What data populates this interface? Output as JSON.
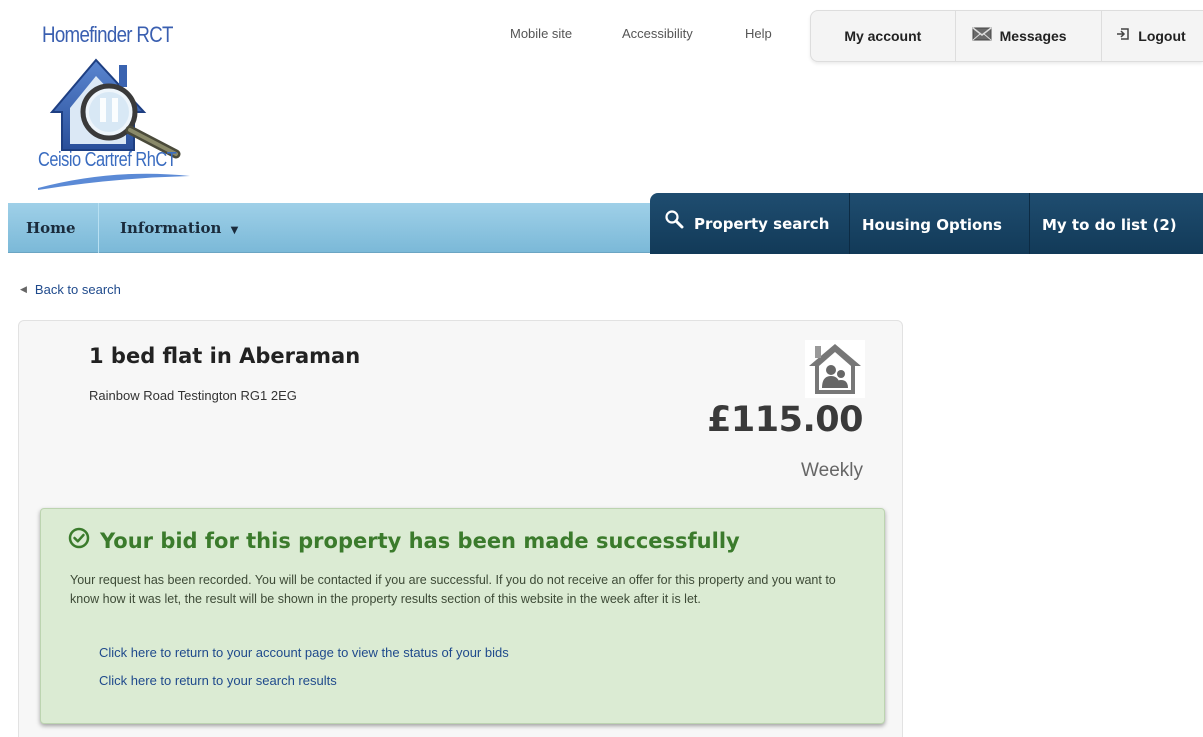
{
  "utility_links": {
    "mobile_site": "Mobile site",
    "accessibility": "Accessibility",
    "help": "Help"
  },
  "account_tabs": {
    "my_account": "My account",
    "messages": "Messages",
    "logout": "Logout"
  },
  "logo": {
    "title": "Homefinder RCT",
    "subtitle": "Ceisio Cartref RhCT"
  },
  "nav": {
    "home": "Home",
    "information": "Information",
    "property_search": "Property search",
    "housing_options": "Housing Options",
    "todo_list": "My to do list (2)"
  },
  "back_link": "Back to search",
  "property": {
    "title": "1 bed flat in Aberaman",
    "address": "Rainbow Road Testington RG1 2EG",
    "price": "£115.00",
    "period": "Weekly"
  },
  "success": {
    "heading": "Your bid for this property has been made successfully",
    "message": "Your request has been recorded. You will be contacted if you are successful. If you do not receive an offer for this property and you want to know how it was let, the result will be shown in the property results section of this website in the week after it is let.",
    "link_account": "Click here to return to your account page to view the status of your bids",
    "link_search": "Click here to return to your search results"
  },
  "colors": {
    "nav_light": "#8ec6e0",
    "nav_dark": "#1a4566",
    "success_bg": "#dbebd3",
    "success_text": "#3b7b2c",
    "link": "#1f4a8c"
  },
  "icons": [
    "envelope-icon",
    "logout-icon",
    "magnifier-icon",
    "caret-down-icon",
    "back-arrow-icon",
    "house-people-icon",
    "check-circle-icon"
  ]
}
